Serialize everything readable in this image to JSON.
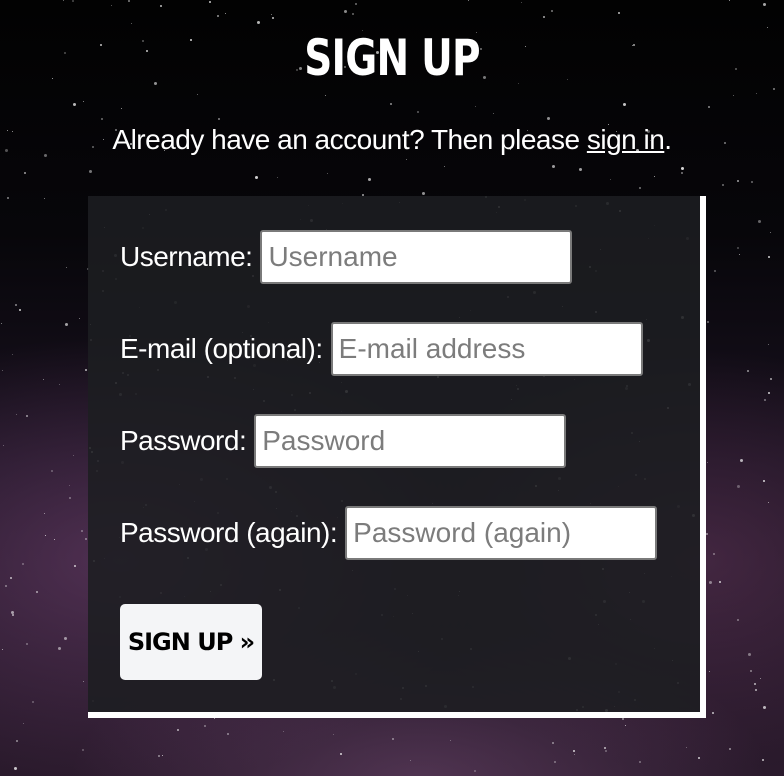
{
  "page": {
    "title": "SIGN UP"
  },
  "signin": {
    "prefix": "Already have an account? Then please ",
    "link_text": "sign in",
    "suffix": "."
  },
  "form": {
    "fields": [
      {
        "label": "Username:",
        "placeholder": "Username",
        "value": ""
      },
      {
        "label": "E-mail (optional):",
        "placeholder": "E-mail address",
        "value": ""
      },
      {
        "label": "Password:",
        "placeholder": "Password",
        "value": ""
      },
      {
        "label": "Password (again):",
        "placeholder": "Password (again)",
        "value": ""
      }
    ],
    "submit_label": "SIGN UP »"
  }
}
